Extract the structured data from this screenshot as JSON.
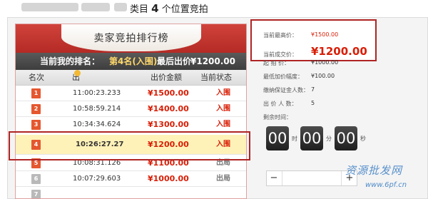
{
  "header": {
    "title_prefix": "类目",
    "title_count": "4",
    "title_suffix": "个位置竞拍"
  },
  "ranking": {
    "title": "卖家竞拍排行榜",
    "summary": {
      "my_rank_label": "当前我的排名：",
      "my_rank_value": "第4名(入围)",
      "last_bid_label": "最后出价：",
      "last_bid_value": "¥1200.00"
    },
    "columns": [
      "名次",
      "出价时间",
      "出价金额",
      "当前状态"
    ],
    "rows": [
      {
        "rank": "1",
        "time": "11:00:23.233",
        "amount": "¥1500.00",
        "status": "入围"
      },
      {
        "rank": "2",
        "time": "10:58:59.214",
        "amount": "¥1400.00",
        "status": "入围"
      },
      {
        "rank": "3",
        "time": "10:34:34.624",
        "amount": "¥1300.00",
        "status": "入围"
      },
      {
        "rank": "4",
        "time": "10:26:27.27",
        "amount": "¥1200.00",
        "status": "入围"
      },
      {
        "rank": "5",
        "time": "10:08:31.126",
        "amount": "¥1100.00",
        "status": "出局"
      },
      {
        "rank": "6",
        "time": "10:07:29.603",
        "amount": "¥1000.00",
        "status": "出局"
      },
      {
        "rank": "7",
        "time": "",
        "amount": "",
        "status": ""
      }
    ]
  },
  "bid": {
    "current_high_label": "当前最高价：",
    "current_high_value": "¥1500.00",
    "current_deal_label": "当前成交价：",
    "current_deal_value": "¥1200.00",
    "start_price_label": "起 拍 价：",
    "start_price_value": "¥1000.00",
    "min_increment_label": "最低加价幅度：",
    "min_increment_value": "¥100.00",
    "deposit_payers_label": "缴纳保证金人数：",
    "deposit_payers_value": "7",
    "bidders_label": "出 价 人 数：",
    "bidders_value": "5",
    "remaining_label": "剩余时间：",
    "timer": {
      "hours": "00",
      "hours_unit": "时",
      "minutes": "00",
      "minutes_unit": "分",
      "seconds": "00",
      "seconds_unit": "秒"
    },
    "stepper": {
      "minus": "−",
      "plus": "+",
      "value": ""
    }
  },
  "watermark": {
    "text": "资源批发网",
    "url": "www.6pf.cn"
  },
  "colors": {
    "accent_red": "#d81e06",
    "ribbon_red": "#c43a33",
    "frame_red": "#b02424",
    "highlight_row": "#fff2b8",
    "timer_digit_bg": "#2b2b2b"
  },
  "icons": [
    "info-icon",
    "rank-badge-icon"
  ]
}
